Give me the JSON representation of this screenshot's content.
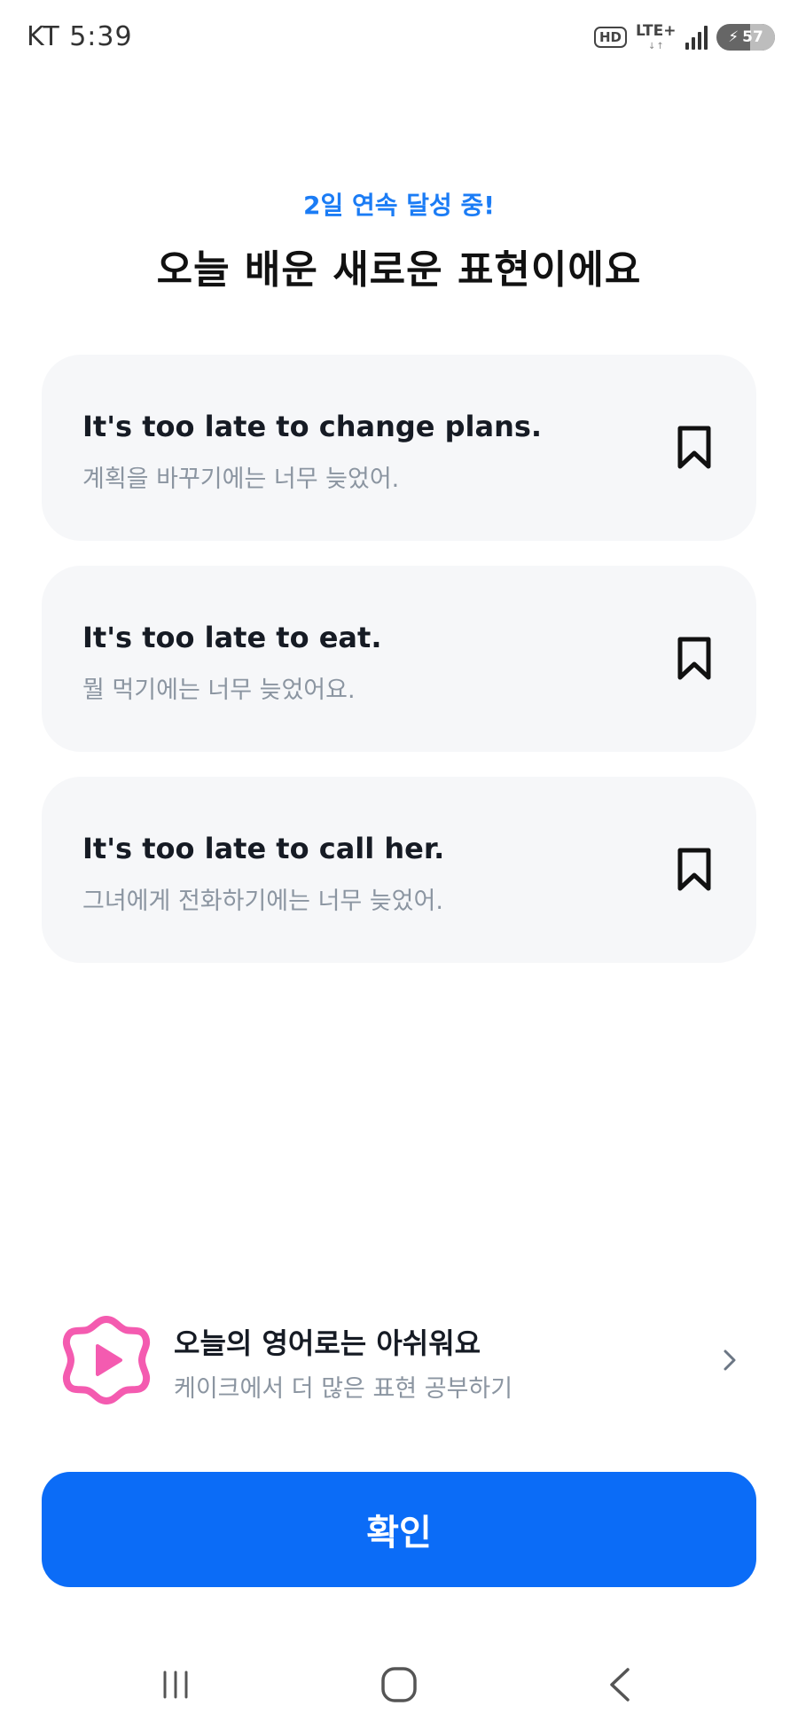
{
  "status_bar": {
    "carrier_time": "KT 5:39",
    "hd_label": "HD",
    "network_label": "LTE+",
    "battery_level": "57"
  },
  "header": {
    "streak": "2일 연속 달성 중!",
    "title": "오늘 배운 새로운 표현이에요"
  },
  "expressions": [
    {
      "english": "It's too late to change plans.",
      "korean": "계획을 바꾸기에는 너무 늦었어."
    },
    {
      "english": "It's too late to eat.",
      "korean": "뭘 먹기에는 너무 늦었어요."
    },
    {
      "english": "It's too late to call her.",
      "korean": "그녀에게 전화하기에는 너무 늦었어."
    }
  ],
  "promo": {
    "title": "오늘의 영어로는 아쉬워요",
    "subtitle": "케이크에서 더 많은 표현 공부하기",
    "logo_icon": "cake-play-icon",
    "accent_color": "#f45bb0"
  },
  "confirm": {
    "label": "확인",
    "color": "#0b6cf7"
  },
  "nav": {
    "recent_icon": "recent-apps-icon",
    "home_icon": "home-icon",
    "back_icon": "back-icon"
  }
}
